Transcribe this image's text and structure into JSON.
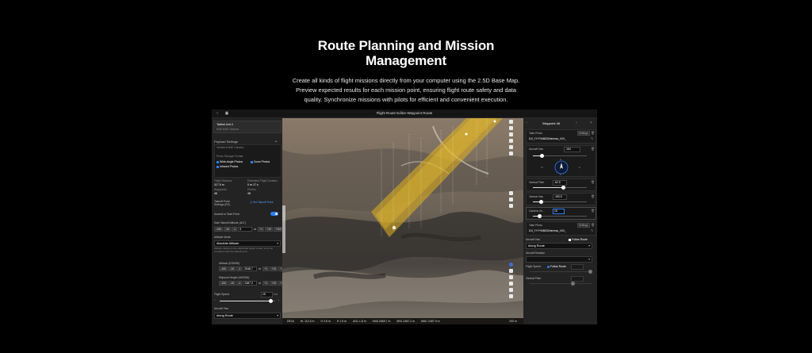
{
  "hero": {
    "title_line1": "Route Planning and Mission",
    "title_line2": "Management",
    "desc_line1": "Create all kinds of flight missions directly from your computer using the 2.5D Base Map.",
    "desc_line2": "Preview expected results for each mission point, ensuring flight route safety and data",
    "desc_line3": "quality. Synchronize missions with pilots for efficient and convenient execution."
  },
  "app": {
    "window_title": "Flight Route Editor-Waypoint Route",
    "left": {
      "device_name": "Tallest Unt-1",
      "device_sub": "M4E  M4E Camera",
      "payload_settings": "Payload Settings",
      "camera_name": "Vehicle's M4E Camera",
      "photo_storage": "Photo Storage Format",
      "opt_wide": "Wide-Angle Photos",
      "opt_zoom": "Zoom Photos",
      "opt_infrared": "Infrared Photos",
      "flight_distance_label": "Flight Distance",
      "flight_distance_value": "117.5 m",
      "est_time_label": "Estimated Flight Duration",
      "est_time_value": "0 m 17 s",
      "waypoints_label": "Waypoints",
      "waypoints_value": "46",
      "photos_label": "Photos",
      "photos_value": "45",
      "takeoff_label": "Takeoff Point Settings (RC)",
      "takeoff_link": "Set Takeoff Point",
      "ascend_label": "Ascend to Start Point",
      "safe_alt_label": "Safe Takeoff Altitude (ALT)",
      "safe_alt_value": "5",
      "alt_mode_label": "Altitude Mode",
      "alt_mode_value": "Absolute Altitude",
      "alt_note": "Altitude relative to the ellipsoidal height model, set to be consistent with the takeoff point.",
      "altitude_label": "Altitude (EGM96)",
      "altitude_value": "2548.7",
      "elevation_label": "Ellipsoid Height (WGS84)",
      "elevation_value": "2487.2",
      "flight_speed_label": "Flight Speed",
      "flight_speed_value": "15",
      "flight_speed_unit": "m/s",
      "flight_speed_level": 0.92,
      "heading_label": "Aircraft Yaw",
      "heading_value": "Along Route",
      "step_m100": "-100",
      "step_m10": "-10",
      "step_m1": "-1",
      "step_p1": "+1",
      "step_p10": "+10",
      "step_p100": "+100",
      "unit_m": "m"
    },
    "right": {
      "waypoint_title": "Waypoint 46",
      "take_photo_1": "Take Photo",
      "file_name_1": "DJI_YYYYMMDDhhmmss_XXX_",
      "aircraft_yaw_label": "Aircraft Yaw",
      "aircraft_yaw_value": "-154",
      "gimbal_pitch_label": "Gimbal Pitch",
      "gimbal_pitch_value": "-62.5",
      "gimbal_yaw_label": "Gimbal Yaw",
      "gimbal_yaw_value": "-153.5",
      "camera_zoom_label": "Camera Zo...",
      "camera_zoom_value": "15",
      "take_photo_2": "Take Photo",
      "file_name_2": "DJI_YYYYMMDDhhmmss_XXX_",
      "aircraft_yaw_sect": "Aircraft Yaw",
      "follow_route": "Follow Route",
      "along_route": "Along Route",
      "aircraft_rotation": "Aircraft Rotation",
      "flight_speed_label": "Flight Speed",
      "follow_route_2": "Follow Route",
      "gimbal_pitch_sect": "Gimbal Pitch",
      "compass_n": "N",
      "compass_s": "S",
      "compass_w": "W",
      "compass_e": "E",
      "tag_edit": "Settings",
      "tag_delete": "delete"
    },
    "map": {
      "status_items": [
        "DE16",
        "HL 112.4 m",
        "H 2.8 m",
        "H 1.5 m",
        "AGL 1.8 m",
        "HAB 2548.7 m",
        "MSL 2487.2 m",
        "NMC 2487.9 m"
      ],
      "scale": "200 m"
    }
  },
  "colors": {
    "accent": "#2f7df6",
    "route_band": "#e2b21e",
    "background": "#000000"
  }
}
